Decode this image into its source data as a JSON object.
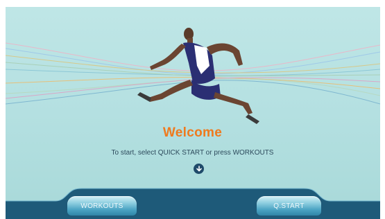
{
  "screen": {
    "welcome_title": "Welcome",
    "instructions": "To start, select QUICK START or press WORKOUTS",
    "down_arrow_icon": "arrow-down-icon"
  },
  "nav": {
    "workouts_label": "WORKOUTS",
    "quick_start_label": "Q.START"
  },
  "colors": {
    "background": "#b4e0e1",
    "welcome_orange": "#ef7a1e",
    "bottom_bar": "#1e5a79",
    "button_highlight": "#8fcfe0"
  }
}
